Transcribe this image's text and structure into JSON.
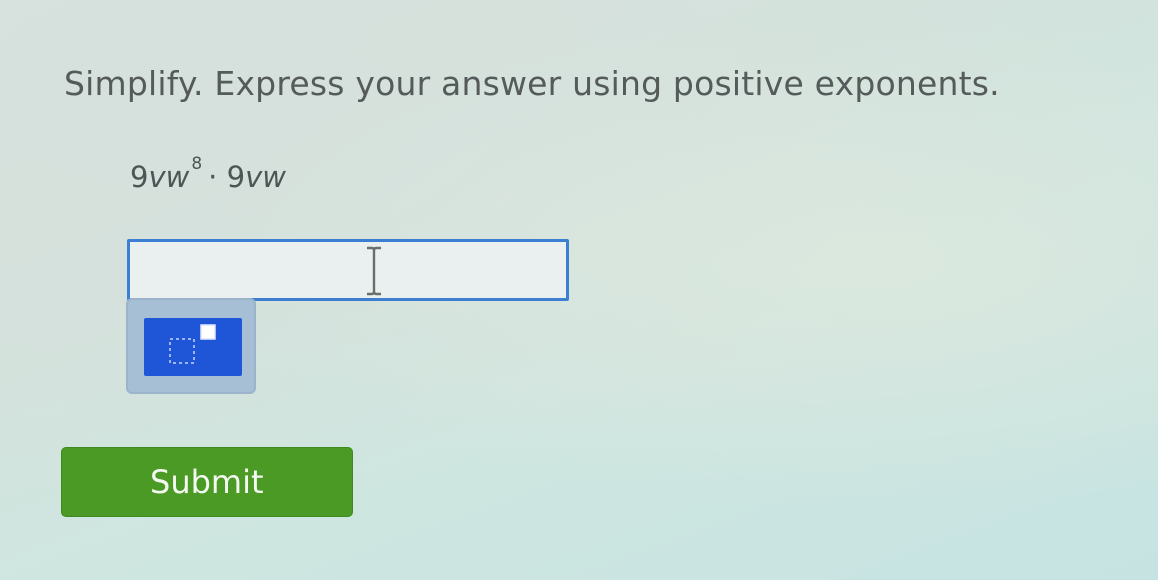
{
  "question": {
    "instruction": "Simplify. Express your answer using positive exponents.",
    "expression": {
      "first_coefficient": "9",
      "first_vars": "vw",
      "first_exponent": "8",
      "operator": "·",
      "second_coefficient": "9",
      "second_vars": "vw"
    }
  },
  "answer": {
    "value": "",
    "cursor_icon": "text-cursor-icon",
    "border_color": "#3c7fd0"
  },
  "palette": {
    "button_icon": "exponent-template-icon",
    "button_color": "#1f56d8"
  },
  "submit": {
    "label": "Submit",
    "color": "#4a9a25"
  }
}
